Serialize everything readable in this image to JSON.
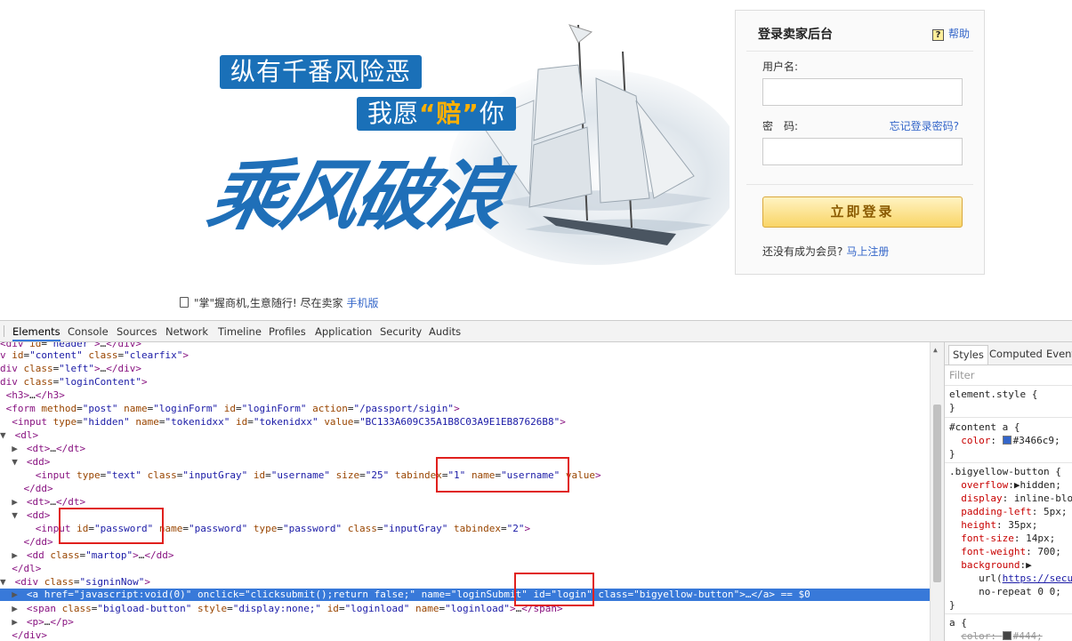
{
  "colors": {
    "link_blue": "#3466c9",
    "devtools_selection": "#3879d9",
    "highlight_box": "#e0201d",
    "slogan_bg": "#1a70b8"
  },
  "banner": {
    "slogan_line1": "纵有千番风险恶",
    "slogan_line2_pre": "我愿",
    "slogan_line2_highlight": "“赔”",
    "slogan_line2_post": "你",
    "brush_text": "乘风破浪"
  },
  "login": {
    "title": "登录卖家后台",
    "help_icon": "question-icon",
    "help_glyph": "?",
    "help_label": "帮助",
    "username_label": "用户名:",
    "password_label": "密　码:",
    "forgot_label": "忘记登录密码?",
    "submit_label": "立即登录",
    "register_prompt": "还没有成为会员?",
    "register_link": "马上注册"
  },
  "mobile": {
    "text": "\"掌\"握商机,生意随行! 尽在卖家",
    "link": "手机版"
  },
  "devtools": {
    "tabs": [
      "Elements",
      "Console",
      "Sources",
      "Network",
      "Timeline",
      "Profiles",
      "Application",
      "Security",
      "Audits"
    ],
    "active_tab": "Elements",
    "styles_tabs": [
      "Styles",
      "Computed",
      "Event"
    ],
    "styles_filter_placeholder": "Filter"
  }
}
